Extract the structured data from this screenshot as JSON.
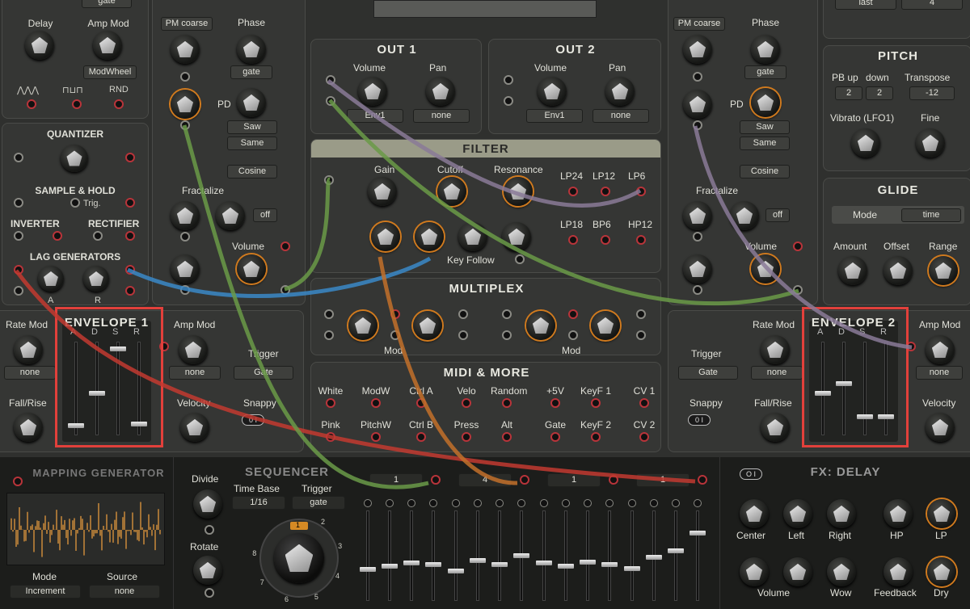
{
  "left": {
    "top_gate": "gate",
    "delay": "Delay",
    "amp_mod": "Amp Mod",
    "amp_mod_value": "ModWheel",
    "rnd": "RND",
    "quantizer": "QUANTIZER",
    "sample_hold": "SAMPLE & HOLD",
    "trig": "Trig.",
    "inverter": "INVERTER",
    "rectifier": "RECTIFIER",
    "lag": "LAG GENERATORS",
    "lag_a": "A",
    "lag_r": "R"
  },
  "osc1": {
    "pm_coarse": "PM coarse",
    "phase": "Phase",
    "phase_value": "gate",
    "pd": "PD",
    "wave1": "Saw",
    "wave2": "Same",
    "wave3": "Cosine",
    "fractalize": "Fractalize",
    "fract_value": "off",
    "volume": "Volume"
  },
  "osc2": {
    "pm_coarse": "PM coarse",
    "phase": "Phase",
    "phase_value": "gate",
    "pd": "PD",
    "wave1": "Saw",
    "wave2": "Same",
    "wave3": "Cosine",
    "fractalize": "Fractalize",
    "fract_value": "off",
    "volume": "Volume"
  },
  "out1": {
    "title": "OUT 1",
    "volume": "Volume",
    "pan": "Pan",
    "vol_value": "Env1",
    "pan_value": "none"
  },
  "out2": {
    "title": "OUT 2",
    "volume": "Volume",
    "pan": "Pan",
    "vol_value": "Env1",
    "pan_value": "none"
  },
  "filter": {
    "title": "FILTER",
    "gain": "Gain",
    "cutoff": "Cutoff",
    "resonance": "Resonance",
    "key_follow": "Key Follow",
    "modes": [
      "LP24",
      "LP12",
      "LP6",
      "LP18",
      "BP6",
      "HP12"
    ]
  },
  "multiplex": {
    "title": "MULTIPLEX",
    "mod": "Mod"
  },
  "midi": {
    "title": "MIDI & MORE",
    "row1": [
      "White",
      "ModW",
      "Ctrl A",
      "Velo",
      "Random",
      "+5V",
      "KeyF 1",
      "CV 1"
    ],
    "row2": [
      "Pink",
      "PitchW",
      "Ctrl B",
      "Press",
      "Alt",
      "Gate",
      "KeyF 2",
      "CV 2"
    ]
  },
  "env1": {
    "title": "ENVELOPE 1",
    "rate_mod": "Rate Mod",
    "rate_value": "none",
    "fall_rise": "Fall/Rise",
    "amp_mod": "Amp Mod",
    "amp_value": "none",
    "velocity": "Velocity",
    "trigger": "Trigger",
    "trigger_value": "Gate",
    "snappy": "Snappy",
    "adsr": [
      "A",
      "D",
      "S",
      "R"
    ],
    "adsr_levels": [
      0.1,
      0.45,
      0.92,
      0.12
    ]
  },
  "env2": {
    "title": "ENVELOPE 2",
    "rate_mod": "Rate Mod",
    "rate_value": "none",
    "fall_rise": "Fall/Rise",
    "amp_mod": "Amp Mod",
    "amp_value": "none",
    "velocity": "Velocity",
    "trigger": "Trigger",
    "trigger_value": "Gate",
    "snappy": "Snappy",
    "adsr": [
      "A",
      "D",
      "S",
      "R"
    ],
    "adsr_levels": [
      0.45,
      0.55,
      0.2,
      0.2
    ]
  },
  "right": {
    "top_last": "last",
    "top_4": "4",
    "pitch": "PITCH",
    "pb_up": "PB up",
    "down": "down",
    "transpose": "Transpose",
    "pb_up_value": "2",
    "down_value": "2",
    "transpose_value": "-12",
    "vibrato": "Vibrato (LFO1)",
    "fine": "Fine",
    "glide": "GLIDE",
    "mode": "Mode",
    "mode_value": "time",
    "amount": "Amount",
    "offset": "Offset",
    "range": "Range"
  },
  "mapping": {
    "title": "MAPPING GENERATOR",
    "mode": "Mode",
    "mode_value": "Increment",
    "source": "Source",
    "source_value": "none"
  },
  "sequencer": {
    "title": "SEQUENCER",
    "divide": "Divide",
    "time_base": "Time Base",
    "time_base_value": "1/16",
    "trigger": "Trigger",
    "trigger_value": "gate",
    "rotate": "Rotate",
    "lanes": [
      "1",
      "4",
      "1",
      "1"
    ],
    "rotate_value": "1",
    "dial_numbers": [
      "2",
      "3",
      "4",
      "5",
      "6",
      "7",
      "8"
    ],
    "step_levels": [
      0.35,
      0.38,
      0.42,
      0.4,
      0.33,
      0.45,
      0.4,
      0.5,
      0.42,
      0.38,
      0.43,
      0.4,
      0.36,
      0.48,
      0.55,
      0.75
    ]
  },
  "delay": {
    "title": "FX: DELAY",
    "power": "O I",
    "center": "Center",
    "left": "Left",
    "right": "Right",
    "hp": "HP",
    "lp": "LP",
    "volume": "Volume",
    "wow": "Wow",
    "feedback": "Feedback",
    "dry": "Dry"
  }
}
